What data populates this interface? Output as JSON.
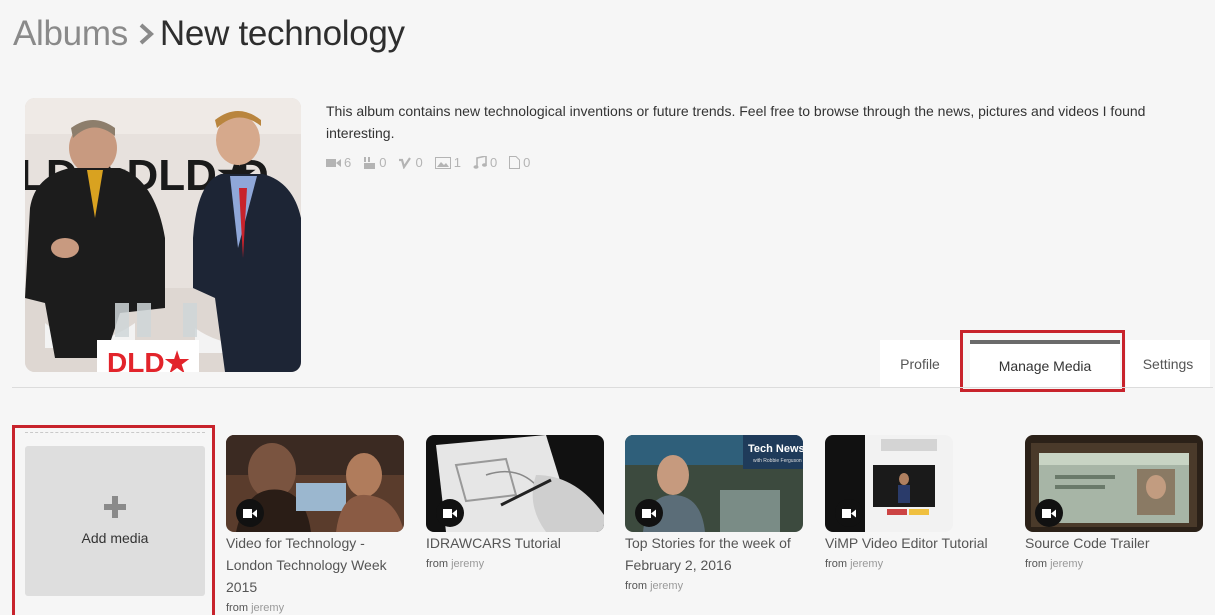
{
  "breadcrumb": {
    "root": "Albums",
    "current": "New technology"
  },
  "album": {
    "description": "This album contains new technological inventions or future trends. Feel free to browse through the news, pictures and videos I found interesting.",
    "stats": {
      "videos": "6",
      "youtube": "0",
      "vimeo": "0",
      "images": "1",
      "audio": "0",
      "documents": "0"
    }
  },
  "tabs": {
    "profile": "Profile",
    "manage_media": "Manage Media",
    "settings": "Settings"
  },
  "add_media_label": "Add media",
  "from_label": "from",
  "media": [
    {
      "title": "Video for Technology - London Technology Week 2015",
      "user": "jeremy"
    },
    {
      "title": "IDRAWCARS Tutorial",
      "user": "jeremy"
    },
    {
      "title": "Top Stories for the week of February 2, 2016",
      "user": "jeremy"
    },
    {
      "title": "ViMP Video Editor Tutorial",
      "user": "jeremy"
    },
    {
      "title": "Source Code Trailer",
      "user": "jeremy"
    }
  ],
  "thumb_texts": {
    "tech_news": "Tech News",
    "tech_news_sub": "with Robbie Ferguson"
  },
  "colors": {
    "highlight": "#c8232c",
    "background": "#f6f6f6"
  }
}
